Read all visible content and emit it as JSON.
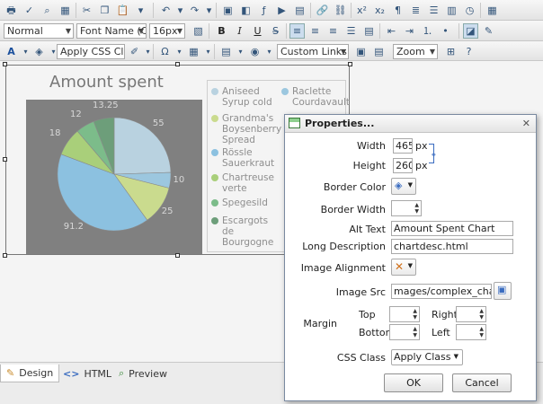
{
  "toolbar": {
    "paragraph_style": "Normal",
    "font_name": "Font Name (CT",
    "font_size": "16px",
    "css_class": "Apply CSS Clas",
    "custom_links": "Custom Links",
    "zoom": "Zoom",
    "icons_row1": [
      "print-icon",
      "spellcheck-icon",
      "find-icon",
      "select-all-icon",
      "cut-icon",
      "copy-icon",
      "paste-icon",
      "paste-options-icon",
      "undo-icon",
      "redo-icon",
      "image-icon",
      "media-icon",
      "flash-icon",
      "video-icon",
      "link-icon",
      "unlink-icon",
      "superscript-icon",
      "subscript-icon",
      "paragraph-icon",
      "format-icon",
      "columns-icon",
      "date-icon",
      "time-icon"
    ],
    "glyph_bold": "B",
    "glyph_italic": "I",
    "glyph_underline": "U",
    "glyph_font_color": "A",
    "glyph_omega": "Ω",
    "glyph_superscript": "x²",
    "glyph_subscript": "x₂",
    "glyph_paragraph": "¶"
  },
  "chart_data": {
    "type": "pie",
    "title": "Amount spent",
    "categories": [
      "Aniseed Syrup cold",
      "Raclette Courdavault",
      "Grandma's Boysenberry Spread",
      "Rössle Sauerkraut",
      "Chartreuse verte",
      "Spegesild",
      "Escargots de Bourgogne"
    ],
    "values": [
      55,
      10,
      25,
      91.2,
      18,
      12,
      13.25
    ],
    "value_labels": [
      "55",
      "10",
      "25",
      "91.2",
      "18",
      "12",
      "13.25"
    ],
    "colors": [
      "#b9d2e0",
      "#9cc7df",
      "#cadb8e",
      "#8cc1e0",
      "#a9cf7a",
      "#7cbc8a",
      "#6d9e7a"
    ],
    "legend_position": "right"
  },
  "tabs": {
    "design": "Design",
    "html": "HTML",
    "preview": "Preview"
  },
  "dialog": {
    "title": "Properties...",
    "width_label": "Width",
    "width_value": "465",
    "height_label": "Height",
    "height_value": "260",
    "unit": "px",
    "border_color_label": "Border Color",
    "border_width_label": "Border Width",
    "alt_text_label": "Alt Text",
    "alt_text_value": "Amount Spent Chart",
    "long_desc_label": "Long Description",
    "long_desc_value": "chartdesc.html",
    "image_alignment_label": "Image Alignment",
    "image_src_label": "Image Src",
    "image_src_value": "mages/complex_chart.jpg",
    "margin_label": "Margin",
    "margin_top": "Top",
    "margin_right": "Right",
    "margin_bottom": "Bottom",
    "margin_left": "Left",
    "css_class_label": "CSS Class",
    "css_class_value": "Apply Class",
    "ok": "OK",
    "cancel": "Cancel"
  }
}
